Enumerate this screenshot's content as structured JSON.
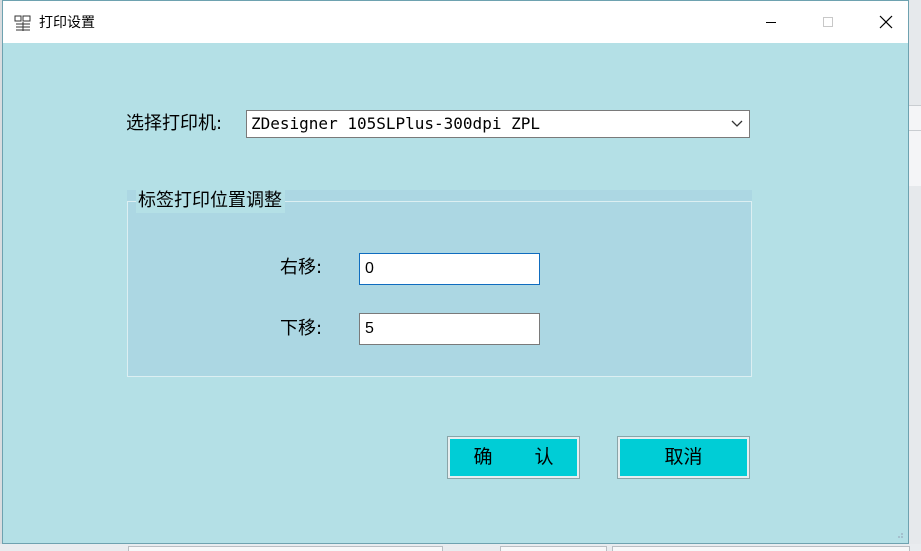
{
  "window": {
    "title": "打印设置",
    "icon": "printer-settings-icon",
    "controls": [
      "minimize-icon",
      "maximize-icon",
      "close-icon"
    ]
  },
  "printer": {
    "label": "选择打印机:",
    "selected": "ZDesigner 105SLPlus-300dpi ZPL",
    "dropdown_icon": "chevron-down-icon"
  },
  "adjust_group": {
    "title": "标签打印位置调整",
    "right_shift": {
      "label": "右移:",
      "value": "0"
    },
    "down_shift": {
      "label": "下移:",
      "value": "5"
    }
  },
  "buttons": {
    "ok": "确 认",
    "cancel": "取消"
  },
  "colors": {
    "dialog_bg": "#b4e0e6",
    "group_bg": "#acd7e3",
    "button_bg": "#00cdd6",
    "focus_border": "#0f6cbf"
  }
}
